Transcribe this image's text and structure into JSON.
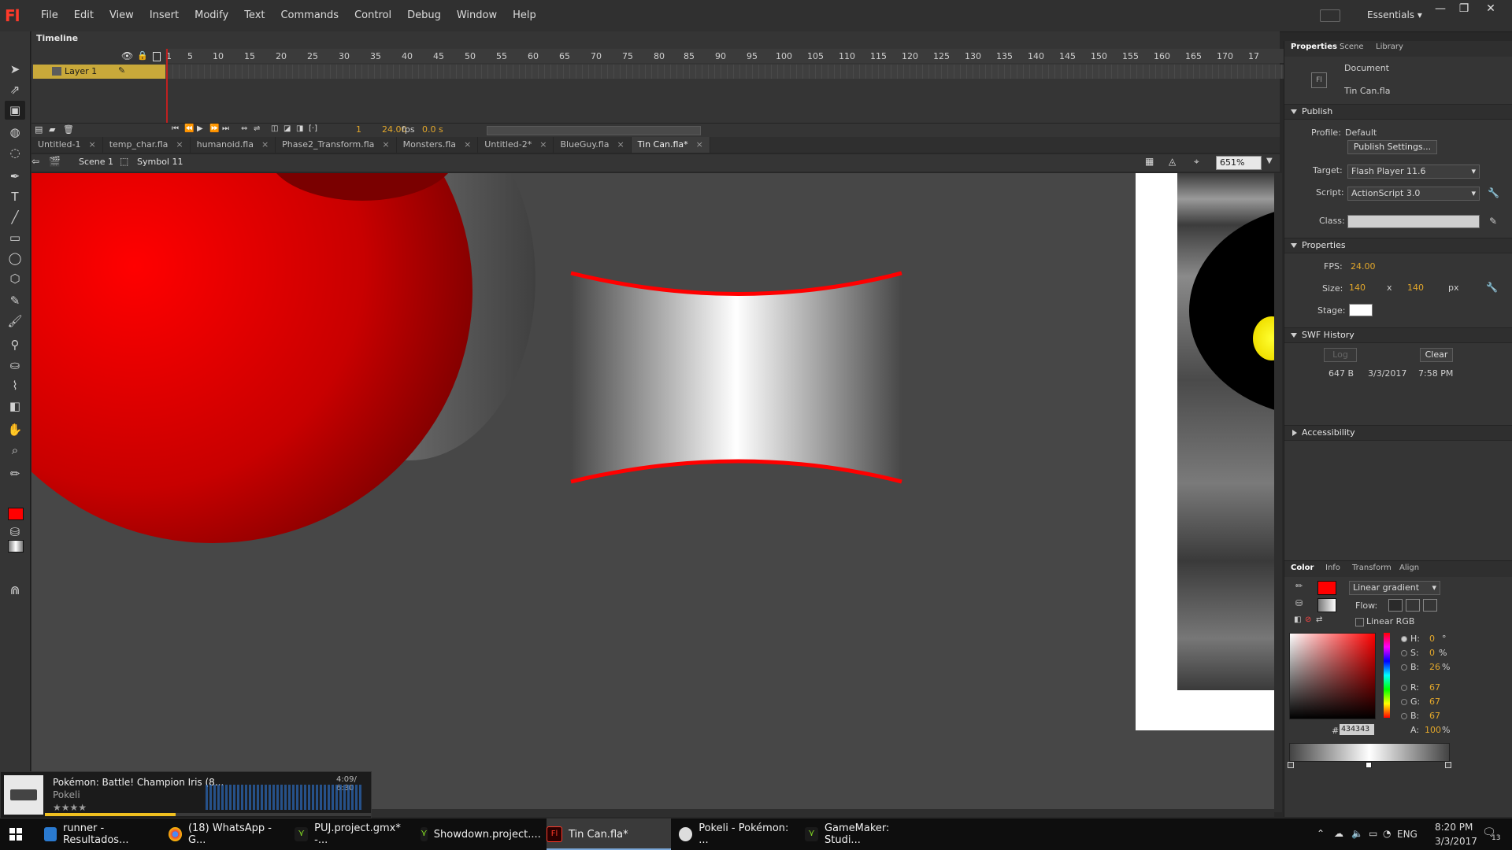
{
  "app": {
    "logo": "Fl",
    "workspace": "Essentials"
  },
  "menu": [
    "File",
    "Edit",
    "View",
    "Insert",
    "Modify",
    "Text",
    "Commands",
    "Control",
    "Debug",
    "Window",
    "Help"
  ],
  "timeline": {
    "tab": "Timeline",
    "ticks": [
      "1",
      "5",
      "10",
      "15",
      "20",
      "25",
      "30",
      "35",
      "40",
      "45",
      "50",
      "55",
      "60",
      "65",
      "70",
      "75",
      "80",
      "85",
      "90",
      "95",
      "100",
      "105",
      "110",
      "115",
      "120",
      "125",
      "130",
      "135",
      "140",
      "145",
      "150",
      "155",
      "160",
      "165",
      "170",
      "17"
    ],
    "layer_name": "Layer 1",
    "current_frame": "1",
    "fps": "24.00",
    "fps_unit": "fps",
    "time": "0.0 s"
  },
  "doc_tabs": [
    {
      "label": "Untitled-1",
      "close": "×"
    },
    {
      "label": "temp_char.fla",
      "close": "×"
    },
    {
      "label": "humanoid.fla",
      "close": "×"
    },
    {
      "label": "Phase2_Transform.fla",
      "close": "×"
    },
    {
      "label": "Monsters.fla",
      "close": "×"
    },
    {
      "label": "Untitled-2*",
      "close": "×"
    },
    {
      "label": "BlueGuy.fla",
      "close": "×"
    },
    {
      "label": "Tin Can.fla*",
      "close": "×"
    }
  ],
  "editbar": {
    "scene": "Scene 1",
    "symbol": "Symbol 11",
    "zoom": "651%"
  },
  "properties": {
    "tabs": [
      "Properties",
      "Scene",
      "Library"
    ],
    "doc_type": "Document",
    "doc_name": "Tin Can.fla",
    "publish": {
      "head": "Publish",
      "profile_label": "Profile:",
      "profile": "Default",
      "publish_settings": "Publish Settings...",
      "target_label": "Target:",
      "target": "Flash Player 11.6",
      "script_label": "Script:",
      "script": "ActionScript 3.0",
      "class_label": "Class:"
    },
    "props": {
      "head": "Properties",
      "fps_label": "FPS:",
      "fps": "24.00",
      "size_label": "Size:",
      "width": "140",
      "x": "x",
      "height": "140",
      "unit": "px",
      "stage_label": "Stage:"
    },
    "swf": {
      "head": "SWF History",
      "log": "Log",
      "clear": "Clear",
      "size": "647 B",
      "date": "3/3/2017",
      "time": "7:58 PM"
    },
    "accessibility": "Accessibility"
  },
  "color_panel": {
    "tabs": [
      "Color",
      "Info",
      "Transform",
      "Align"
    ],
    "fill_type": "Linear gradient",
    "flow_label": "Flow:",
    "linear_rgb": "Linear RGB",
    "h_label": "H:",
    "h": "0",
    "h_unit": "°",
    "s_label": "S:",
    "s": "0",
    "s_unit": "%",
    "b_label": "B:",
    "b": "26",
    "b_unit": "%",
    "r_label": "R:",
    "r": "67",
    "g_label": "G:",
    "g": "67",
    "bb_label": "B:",
    "bb": "67",
    "hex_label": "#",
    "hex": "434343",
    "a_label": "A:",
    "a": "100",
    "a_unit": "%",
    "stroke_color": "#ff0000"
  },
  "music": {
    "title": "Pokémon: Battle! Champion Iris (8...",
    "artist": "Pokeli",
    "time": "4:09/ 6:30",
    "rating": "★★★★",
    "rating_max": 5
  },
  "taskbar": {
    "items": [
      {
        "label": "runner - Resultados..."
      },
      {
        "label": "(18) WhatsApp - G..."
      },
      {
        "label": "PUJ.project.gmx* -..."
      },
      {
        "label": "Showdown.project...."
      },
      {
        "label": "Tin Can.fla*"
      },
      {
        "label": "Pokeli - Pokémon: ..."
      },
      {
        "label": "GameMaker: Studi..."
      }
    ],
    "lang": "ENG",
    "time": "8:20 PM",
    "date": "3/3/2017",
    "notif": "13"
  }
}
